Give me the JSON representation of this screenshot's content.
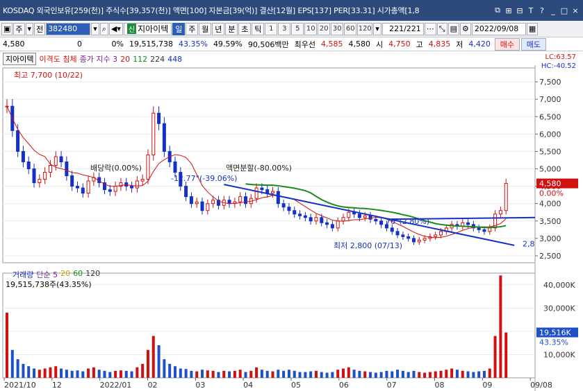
{
  "titlebar": {
    "title": "KOSDAQ 외국인보유[259(천)] 주식수[39,357(천)] 액면[100] 자본금[39(억)] 결산[12월] EPS[137] PER[33.31] 시가총액[1,8",
    "buttons": [
      "⧉",
      "⊞",
      "⊟",
      "T",
      "?",
      "_",
      "□",
      "×"
    ]
  },
  "toolbar": {
    "menu_label": "주",
    "menu_label2": "전",
    "code": "382480",
    "stock_name": "지아이텍",
    "periods": [
      "일",
      "주",
      "월",
      "년",
      "분",
      "초",
      "틱"
    ],
    "selected_period": "일",
    "intervals": [
      "1",
      "3",
      "5",
      "10",
      "20",
      "30",
      "60",
      "120"
    ],
    "count": "221/221",
    "date": "2022/09/08"
  },
  "quote": {
    "price": "4,580",
    "change": "0",
    "change_pct": "0%",
    "volume": "19,515,738",
    "volume_pct": "43.35%",
    "ratio": "49.59%",
    "amount": "90,506백만",
    "best_label": "최우선",
    "best_ask": "4,585",
    "best_bid": "4,580",
    "open_label": "시",
    "open": "4,750",
    "high_label": "고",
    "high": "4,835",
    "low_label": "저",
    "low": "4,420",
    "buy_label": "매수",
    "sell_label": "매도"
  },
  "legend": {
    "name": "지아이텍",
    "indicator": "이격도 침체",
    "ma_label": "종가 지수 3",
    "ma_20": "20",
    "ma_112": "112",
    "ma_224": "224",
    "ma_448": "448",
    "lc": "LC:63.57",
    "hc": "HC:-40.52"
  },
  "annotations": {
    "high": "최고 7,700 (10/22)",
    "low": "최저 2,800 (07/13)",
    "dividend": "배당락(0.00%)",
    "split": "액면분할(-80.00%)",
    "trend1": "-12.77°(-39.06%)",
    "trend2": "76°(2.80%)",
    "trend_end": "2,8"
  },
  "price_labels": {
    "current": "4,580",
    "current_pct": "0.00%"
  },
  "volume_panel": {
    "title": "거래량",
    "ma_label": "단순 5",
    "ma_20": "20",
    "ma_60": "60",
    "ma_120": "120",
    "current": "19,515,738주(43.35%)",
    "current_box": "19,516K",
    "current_pct": "43.35%"
  },
  "colors": {
    "up": "#d21010",
    "down": "#1530c8",
    "ma20": "#d21010",
    "ma112": "#1a8a1a",
    "trendline": "#1530c8",
    "vol_up": "#d21010",
    "vol_down": "#1e50c8"
  },
  "chart_data": {
    "type": "candlestick",
    "y_axis": [
      "7,500",
      "7,000",
      "6,500",
      "6,000",
      "5,500",
      "5,000",
      "4,500",
      "4,000",
      "3,500",
      "3,000",
      "2,500"
    ],
    "ylim": [
      2300,
      7900
    ],
    "x_labels": [
      "2021/10",
      "12",
      "2022/01",
      "02",
      "03",
      "04",
      "05",
      "06",
      "07",
      "08",
      "09",
      "09/08"
    ],
    "vol_axis": [
      "40,000K",
      "30,000K",
      "20,000K",
      "10,000K"
    ],
    "vol_ylim": [
      0,
      45000
    ],
    "close_series": [
      6800,
      6100,
      5500,
      5200,
      5000,
      4600,
      4700,
      4900,
      5100,
      5350,
      5200,
      4800,
      4500,
      4450,
      4300,
      4650,
      4750,
      4600,
      4400,
      4350,
      4500,
      4600,
      4500,
      4450,
      4650,
      4700,
      5400,
      6600,
      6300,
      5500,
      5200,
      4900,
      4500,
      4200,
      4000,
      4050,
      3800,
      4000,
      4100,
      3950,
      4100,
      4000,
      4050,
      4200,
      4000,
      4150,
      4450,
      4400,
      4300,
      4350,
      4000,
      3900,
      3800,
      3700,
      3650,
      3600,
      3500,
      3600,
      3450,
      3400,
      3300,
      3500,
      3600,
      3750,
      3700,
      3600,
      3650,
      3550,
      3500,
      3400,
      3300,
      3200,
      3100,
      3050,
      3000,
      2900,
      2950,
      3000,
      3050,
      3100,
      3200,
      3300,
      3400,
      3350,
      3450,
      3400,
      3300,
      3250,
      3200,
      3300,
      3700,
      3800,
      4580
    ],
    "vol_series": [
      28000,
      12000,
      8000,
      6000,
      5000,
      4000,
      3500,
      4000,
      4500,
      5000,
      4000,
      3500,
      3000,
      3200,
      2800,
      4000,
      4500,
      3500,
      3000,
      2500,
      3000,
      3200,
      3000,
      2800,
      4500,
      6000,
      12000,
      18000,
      14000,
      8000,
      6000,
      5000,
      4000,
      3800,
      3000,
      2800,
      3500,
      3200,
      3000,
      2500,
      3000,
      2800,
      3000,
      3500,
      2500,
      3000,
      4500,
      3500,
      3000,
      2800,
      3500,
      3000,
      3500,
      3000,
      2500,
      2500,
      2800,
      3000,
      2500,
      2200,
      2500,
      3500,
      4000,
      4500,
      3500,
      3000,
      2800,
      2500,
      2200,
      2500,
      3000,
      2800,
      3500,
      3000,
      2500,
      3000,
      2500,
      2200,
      2500,
      2800,
      3000,
      3500,
      4000,
      3500,
      3000,
      2800,
      2500,
      2800,
      3000,
      4000,
      18000,
      44000,
      19500
    ]
  }
}
